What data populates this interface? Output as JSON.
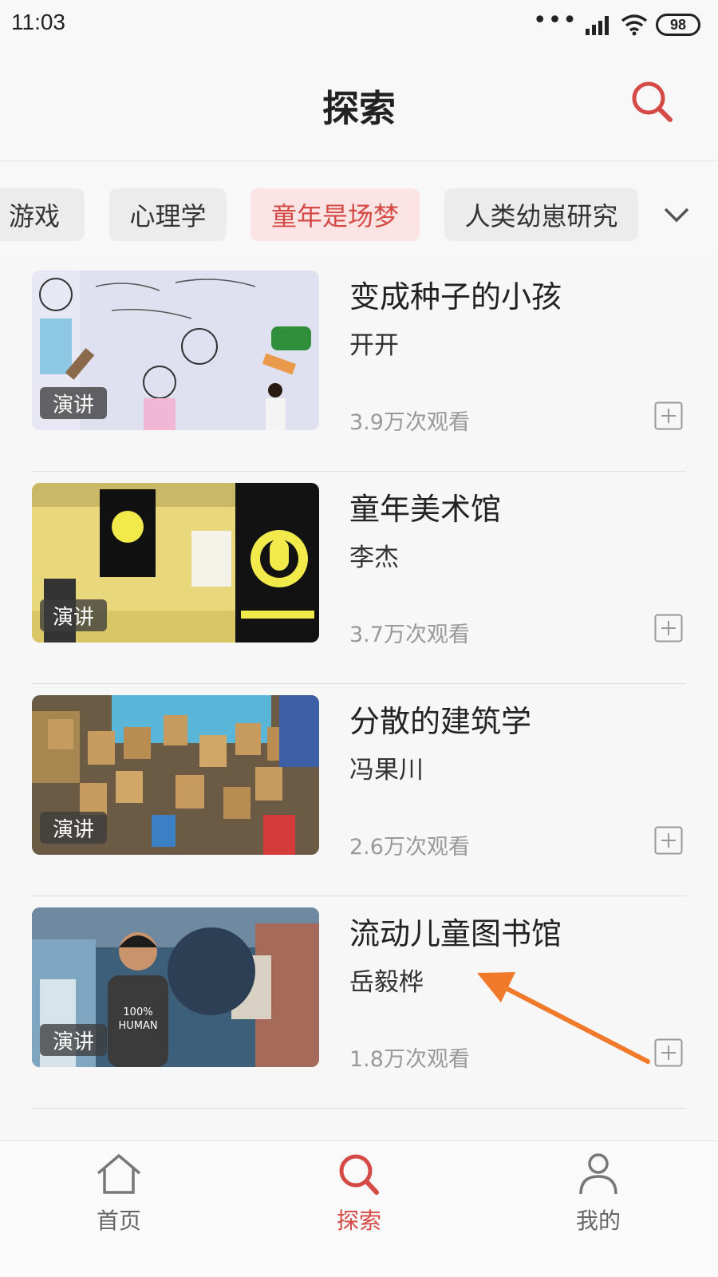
{
  "status": {
    "time": "11:03",
    "battery": "98"
  },
  "header": {
    "title": "探索"
  },
  "tabs": [
    {
      "label": "游戏",
      "active": false
    },
    {
      "label": "心理学",
      "active": false
    },
    {
      "label": "童年是场梦",
      "active": true
    },
    {
      "label": "人类幼崽研究",
      "active": false
    }
  ],
  "items": [
    {
      "title": "变成种子的小孩",
      "author": "开开",
      "views": "3.9万次观看",
      "badge": "演讲"
    },
    {
      "title": "童年美术馆",
      "author": "李杰",
      "views": "3.7万次观看",
      "badge": "演讲"
    },
    {
      "title": "分散的建筑学",
      "author": "冯果川",
      "views": "2.6万次观看",
      "badge": "演讲"
    },
    {
      "title": "流动儿童图书馆",
      "author": "岳毅桦",
      "views": "1.8万次观看",
      "badge": "演讲"
    }
  ],
  "nav": [
    {
      "label": "首页",
      "icon": "home-icon",
      "active": false
    },
    {
      "label": "探索",
      "icon": "search-icon",
      "active": true
    },
    {
      "label": "我的",
      "icon": "profile-icon",
      "active": false
    }
  ],
  "colors": {
    "accent": "#d54a45",
    "annotation_arrow": "#f07a2a"
  }
}
